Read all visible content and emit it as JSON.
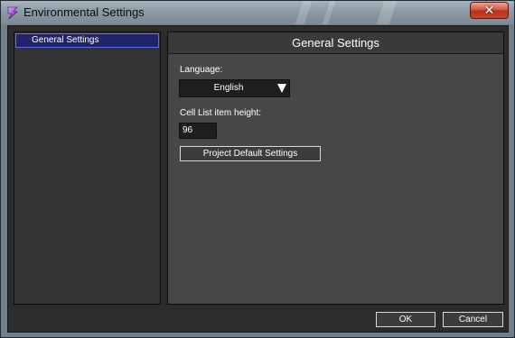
{
  "window": {
    "title": "Environmental Settings",
    "close_symbol": "✕",
    "app_icon": "app-logo-icon"
  },
  "sidebar": {
    "items": [
      {
        "label": "General Settings",
        "selected": true
      }
    ]
  },
  "panel": {
    "title": "General Settings",
    "language_label": "Language:",
    "language_value": "English",
    "cell_height_label": "Cell List item height:",
    "cell_height_value": "96",
    "project_defaults_label": "Project Default Settings"
  },
  "footer": {
    "ok_label": "OK",
    "cancel_label": "Cancel"
  },
  "colors": {
    "selection_bg": "#23236b",
    "selection_border": "#5a73e0",
    "close_button": "#c9452e"
  }
}
